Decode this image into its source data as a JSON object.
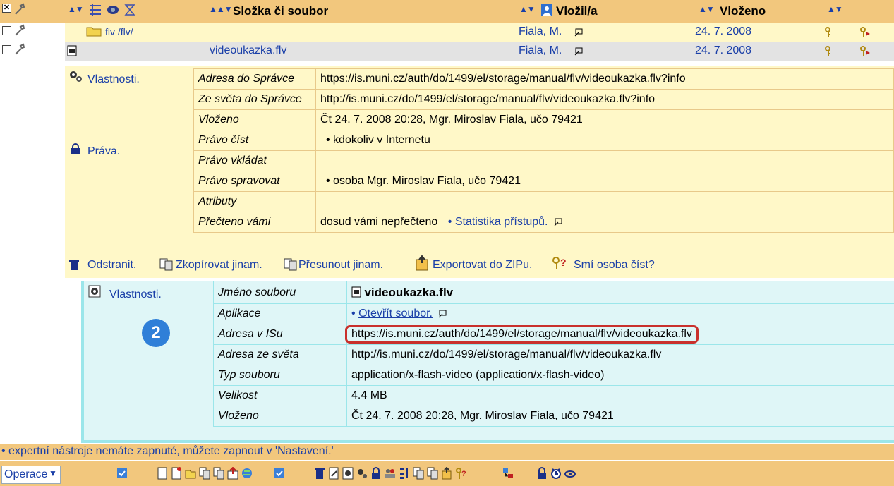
{
  "header": {
    "col_name": "Složka či soubor",
    "col_author": "Vložil/a",
    "col_date": "Vloženo"
  },
  "rows": [
    {
      "name": "flv /flv/",
      "author": "Fiala, M.",
      "date": "24. 7. 2008"
    },
    {
      "name": "videoukazka.flv",
      "author": "Fiala, M.",
      "date": "24. 7. 2008"
    }
  ],
  "props": {
    "section_label": "Vlastnosti.",
    "rights_label": "Práva.",
    "items": [
      {
        "label": "Adresa do Správce",
        "value": "https://is.muni.cz/auth/do/1499/el/storage/manual/flv/videoukazka.flv?info"
      },
      {
        "label": "Ze světa do Správce",
        "value": "http://is.muni.cz/do/1499/el/storage/manual/flv/videoukazka.flv?info"
      },
      {
        "label": "Vloženo",
        "value": "Čt 24. 7. 2008 20:28, Mgr. Miroslav Fiala, učo 79421"
      },
      {
        "label": "Právo číst",
        "value": "• kdokoliv v Internetu"
      },
      {
        "label": "Právo vkládat",
        "value": ""
      },
      {
        "label": "Právo spravovat",
        "value": "• osoba Mgr. Miroslav Fiala, učo 79421"
      },
      {
        "label": "Atributy",
        "value": ""
      },
      {
        "label": "Přečteno vámi",
        "value": "dosud vámi nepřečteno"
      }
    ],
    "stats_link": "Statistika přístupů."
  },
  "ops": {
    "remove": "Odstranit.",
    "copy": "Zkopírovat jinam.",
    "move": "Přesunout jinam.",
    "export": "Exportovat do ZIPu.",
    "can_read": "Smí osoba číst?"
  },
  "file": {
    "section_label": "Vlastnosti.",
    "badge": "2",
    "items": [
      {
        "label": "Jméno souboru",
        "value": "videoukazka.flv"
      },
      {
        "label": "Aplikace",
        "value": "Otevřít soubor."
      },
      {
        "label": "Adresa v ISu",
        "value": "https://is.muni.cz/auth/do/1499/el/storage/manual/flv/videoukazka.flv"
      },
      {
        "label": "Adresa ze světa",
        "value": "http://is.muni.cz/do/1499/el/storage/manual/flv/videoukazka.flv"
      },
      {
        "label": "Typ souboru",
        "value": "application/x-flash-video (application/x-flash-video)"
      },
      {
        "label": "Velikost",
        "value": "4.4 MB"
      },
      {
        "label": "Vloženo",
        "value": "Čt 24. 7. 2008 20:28, Mgr. Miroslav Fiala, učo 79421"
      }
    ]
  },
  "footer_note": "• expertní nástroje nemáte zapnuté, můžete zapnout v 'Nastavení.'",
  "bottom": {
    "operations": "Operace"
  },
  "colors": {
    "header": "#f2c77d",
    "panel": "#fff8c8",
    "file_panel": "#dff6f7",
    "highlight": "#c9302c",
    "badge": "#2f7fd8"
  }
}
